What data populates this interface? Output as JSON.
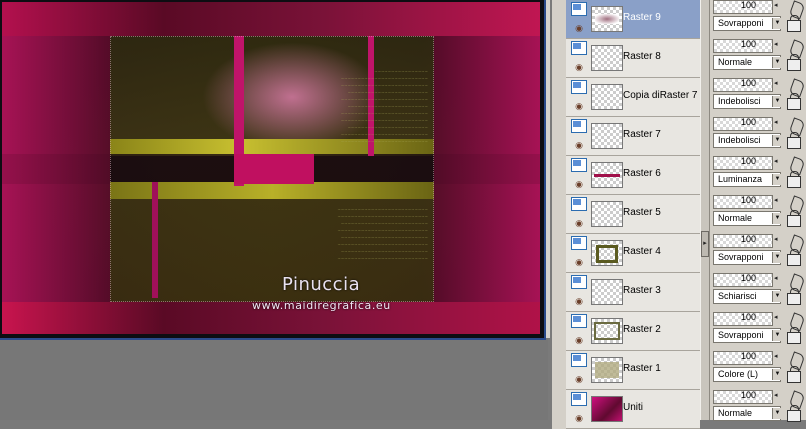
{
  "artwork": {
    "signature": "Pinuccia",
    "website": "www.maidiregrafica.eu"
  },
  "layers": [
    {
      "name": "Raster 9",
      "opacity": "100",
      "blend": "Sovrapponi",
      "selected": true,
      "thumb": "raster9"
    },
    {
      "name": "Raster 8",
      "opacity": "100",
      "blend": "Normale",
      "selected": false,
      "thumb": "empty"
    },
    {
      "name": "Copia diRaster 7",
      "opacity": "100",
      "blend": "Indebolisci",
      "selected": false,
      "thumb": "empty"
    },
    {
      "name": "Raster 7",
      "opacity": "100",
      "blend": "Indebolisci",
      "selected": false,
      "thumb": "empty"
    },
    {
      "name": "Raster 6",
      "opacity": "100",
      "blend": "Luminanza",
      "selected": false,
      "thumb": "raster6"
    },
    {
      "name": "Raster 5",
      "opacity": "100",
      "blend": "Normale",
      "selected": false,
      "thumb": "empty"
    },
    {
      "name": "Raster 4",
      "opacity": "100",
      "blend": "Sovrapponi",
      "selected": false,
      "thumb": "raster4"
    },
    {
      "name": "Raster 3",
      "opacity": "100",
      "blend": "Schiarisci",
      "selected": false,
      "thumb": "empty"
    },
    {
      "name": "Raster 2",
      "opacity": "100",
      "blend": "Sovrapponi",
      "selected": false,
      "thumb": "raster2"
    },
    {
      "name": "Raster 1",
      "opacity": "100",
      "blend": "Colore (L)",
      "selected": false,
      "thumb": "raster1"
    },
    {
      "name": "Uniti",
      "opacity": "100",
      "blend": "Normale",
      "selected": false,
      "thumb": "uniti"
    }
  ],
  "icons": {
    "visibility": "layer-visibility-icon",
    "eye": "eye-icon",
    "lock": "lock-icon",
    "brush": "brush-icon",
    "collapse": "chevron-right-icon"
  },
  "colors": {
    "selected_row": "#8aa0c8",
    "magenta": "#c0146a",
    "olive": "#b8b020"
  }
}
